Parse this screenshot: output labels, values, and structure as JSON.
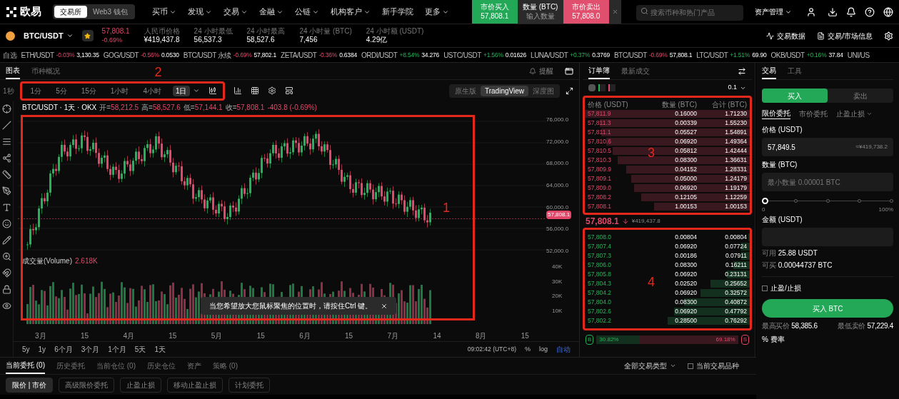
{
  "header": {
    "logo": "欧易",
    "mode_toggle": [
      {
        "label": "交易所",
        "selected": true
      },
      {
        "label": "Web3 钱包",
        "selected": false
      }
    ],
    "nav": [
      {
        "label": "买币",
        "dropdown": true
      },
      {
        "label": "发现",
        "dropdown": true
      },
      {
        "label": "交易",
        "dropdown": true
      },
      {
        "label": "金融",
        "dropdown": true
      },
      {
        "label": "公链",
        "dropdown": true
      },
      {
        "label": "机构客户",
        "dropdown": true
      },
      {
        "label": "新手学院",
        "dropdown": false
      },
      {
        "label": "更多",
        "dropdown": true
      }
    ],
    "quick_trade": {
      "buy_label": "市价买入",
      "buy_price": "57,808.1",
      "amount_label": "数量 (BTC)",
      "amount_placeholder": "输入数量",
      "sell_label": "市价卖出",
      "sell_price": "57,808.0"
    },
    "search": {
      "placeholder": "搜索币种和热门产品"
    },
    "assets_menu": "资产管理"
  },
  "pair_bar": {
    "pair": "BTC/USDT",
    "favorite": true,
    "price": "57,808.1",
    "change": "-0.69%",
    "rising": false,
    "stats": [
      {
        "label": "人民币价格",
        "value": "¥419,437.8"
      },
      {
        "label": "24 小时最低",
        "value": "56,537.3"
      },
      {
        "label": "24 小时最高",
        "value": "58,527.6"
      },
      {
        "label": "24 小时量 (BTC)",
        "value": "7,456"
      },
      {
        "label": "24 小时额 (USDT)",
        "value": "4.29亿"
      }
    ],
    "links": [
      {
        "label": "交易数据",
        "kind": "activity"
      },
      {
        "label": "交易/市场信息",
        "kind": "info"
      }
    ]
  },
  "tickers": {
    "watchlist": "自选",
    "items": [
      {
        "pair": "ETH/USDT",
        "change": "-0.03%",
        "price": "3,130.35",
        "rising": false
      },
      {
        "pair": "GOG/USDT",
        "change": "-0.56%",
        "price": "0.0530",
        "rising": false
      },
      {
        "pair": "BTC/USDT 永续",
        "change": "-0.69%",
        "price": "57,802.1",
        "rising": false
      },
      {
        "pair": "ZETA/USDT",
        "change": "-0.36%",
        "price": "0.6384",
        "rising": false
      },
      {
        "pair": "ORDI/USDT",
        "change": "+8.54%",
        "price": "34.276",
        "rising": true
      },
      {
        "pair": "USTC/USDT",
        "change": "+1.56%",
        "price": "0.01626",
        "rising": true
      },
      {
        "pair": "LUNA/USDT",
        "change": "+0.37%",
        "price": "0.3769",
        "rising": true
      },
      {
        "pair": "BTC/USDT",
        "change": "-0.69%",
        "price": "57,808.1",
        "rising": false
      },
      {
        "pair": "LTC/USDT",
        "change": "+1.51%",
        "price": "69.90",
        "rising": true
      },
      {
        "pair": "OKB/USDT",
        "change": "+0.16%",
        "price": "37.84",
        "rising": true
      },
      {
        "pair": "UNI/US"
      }
    ]
  },
  "chart": {
    "tabs": [
      {
        "label": "图表",
        "selected": true
      },
      {
        "label": "币种概况",
        "selected": false
      }
    ],
    "alert": "提醒",
    "first_interval": "1秒",
    "intervals": [
      {
        "label": "1分",
        "selected": false
      },
      {
        "label": "5分",
        "selected": false
      },
      {
        "label": "15分",
        "selected": false
      },
      {
        "label": "1小时",
        "selected": false
      },
      {
        "label": "4小时",
        "selected": false
      },
      {
        "label": "1日",
        "selected": true
      }
    ],
    "views": [
      {
        "label": "原生版",
        "selected": false
      },
      {
        "label": "TradingView",
        "selected": true
      },
      {
        "label": "深度图",
        "selected": false
      }
    ],
    "legend_title": "BTC/USDT · 1天 · OKX",
    "legend_values": [
      {
        "label": "开=",
        "value": "58,212.5"
      },
      {
        "label": "高=",
        "value": "58,527.6"
      },
      {
        "label": "低=",
        "value": "57,144.1"
      },
      {
        "label": "收=",
        "value": "57,808.1"
      }
    ],
    "legend_change": "-403.8 (-0.69%)",
    "price_ticks": [
      "76,000.0",
      "72,000.0",
      "68,000.0",
      "64,000.0",
      "60,000.0",
      "56,000.0",
      "52,000.0"
    ],
    "last_price": "57,808.1",
    "volume_label": "成交量(Volume)",
    "volume_value": "2.618K",
    "volume_ticks": [
      "40K",
      "30K",
      "20K",
      "10K"
    ],
    "x_ticks": [
      "3月",
      "15",
      "4月",
      "15",
      "5月",
      "15",
      "6月",
      "15",
      "7月",
      "14",
      "8月",
      "15"
    ],
    "toast": "当您希望放大您鼠标聚焦的位置时，请按住Ctrl 键。",
    "ranges": [
      "5y",
      "1y",
      "6个月",
      "3个月",
      "1个月",
      "5天",
      "1天"
    ],
    "clock": "09:02:42 (UTC+8)",
    "percent": "%",
    "log": "log",
    "auto": "自动"
  },
  "annotations": [
    {
      "label": "1"
    },
    {
      "label": "2"
    },
    {
      "label": "3"
    },
    {
      "label": "4"
    }
  ],
  "order_book": {
    "tabs": [
      {
        "label": "订单簿",
        "selected": true
      },
      {
        "label": "最新成交",
        "selected": false
      }
    ],
    "precision": "0.1",
    "columns": [
      "价格 (USDT)",
      "数量 (BTC)",
      "合计 (BTC)"
    ],
    "asks": [
      {
        "price": "57,811.9",
        "amount": "0.16000",
        "total": "1.71230",
        "level": 1.0
      },
      {
        "price": "57,811.3",
        "amount": "0.00339",
        "total": "1.55230",
        "level": 0.91
      },
      {
        "price": "57,811.1",
        "amount": "0.05527",
        "total": "1.54891",
        "level": 0.9
      },
      {
        "price": "57,810.6",
        "amount": "0.06920",
        "total": "1.49364",
        "level": 0.87
      },
      {
        "price": "57,810.5",
        "amount": "0.05812",
        "total": "1.42444",
        "level": 0.83
      },
      {
        "price": "57,810.3",
        "amount": "0.08300",
        "total": "1.36631",
        "level": 0.8
      },
      {
        "price": "57,809.9",
        "amount": "0.04152",
        "total": "1.28331",
        "level": 0.75
      },
      {
        "price": "57,809.1",
        "amount": "0.05000",
        "total": "1.24179",
        "level": 0.72
      },
      {
        "price": "57,809.0",
        "amount": "0.06920",
        "total": "1.19179",
        "level": 0.7
      },
      {
        "price": "57,808.2",
        "amount": "0.12105",
        "total": "1.12259",
        "level": 0.66
      },
      {
        "price": "57,808.1",
        "amount": "1.00153",
        "total": "1.00153",
        "level": 0.58
      }
    ],
    "mid_price": "57,808.1",
    "mid_fiat": "¥419,437.8",
    "bids": [
      {
        "price": "57,808.0",
        "amount": "0.00804",
        "total": "0.00804",
        "level": 0.01
      },
      {
        "price": "57,807.4",
        "amount": "0.06920",
        "total": "0.07724",
        "level": 0.05
      },
      {
        "price": "57,807.3",
        "amount": "0.00186",
        "total": "0.07911",
        "level": 0.05
      },
      {
        "price": "57,806.0",
        "amount": "0.08300",
        "total": "0.16211",
        "level": 0.1
      },
      {
        "price": "57,805.8",
        "amount": "0.06920",
        "total": "0.23131",
        "level": 0.14
      },
      {
        "price": "57,804.3",
        "amount": "0.02520",
        "total": "0.25652",
        "level": 0.24
      },
      {
        "price": "57,804.2",
        "amount": "0.06920",
        "total": "0.32572",
        "level": 0.3
      },
      {
        "price": "57,804.0",
        "amount": "0.08300",
        "total": "0.40872",
        "level": 0.4
      },
      {
        "price": "57,802.6",
        "amount": "0.06920",
        "total": "0.47792",
        "level": 0.46
      },
      {
        "price": "57,802.2",
        "amount": "0.28500",
        "total": "0.76292",
        "level": 0.5
      }
    ],
    "ratio": {
      "buy_label": "B",
      "buy_share": "30.82%",
      "sell_share": "69.18%",
      "sell_label": "S",
      "level": 0.3082
    }
  },
  "trade_panel": {
    "tabs": [
      {
        "label": "交易",
        "selected": true
      },
      {
        "label": "工具",
        "selected": false
      }
    ],
    "sides": [
      {
        "label": "买入",
        "selected": true
      },
      {
        "label": "卖出",
        "selected": false
      }
    ],
    "order_types": [
      {
        "label": "限价委托",
        "selected": true,
        "dropdown": false
      },
      {
        "label": "市价委托",
        "selected": false,
        "dropdown": false
      },
      {
        "label": "止盈止损",
        "selected": false,
        "dropdown": true
      }
    ],
    "price_label": "价格 (USDT)",
    "price_value": "57,849.5",
    "price_fiat": "≈¥419,738.2",
    "amount_label": "数量 (BTC)",
    "amount_placeholder": "最小数量 0.00001 BTC",
    "slider": {
      "level": 0,
      "min_label": "0",
      "max_label": "100%"
    },
    "total_label": "金额 (USDT)",
    "available": [
      {
        "label": "可用",
        "value": "25.88 USDT"
      },
      {
        "label": "可买",
        "value": "0.00044737 BTC"
      }
    ],
    "tp_sl": {
      "label": "止盈/止损",
      "checked": false
    },
    "submit": "买入 BTC",
    "limits": [
      {
        "label": "最高买价",
        "value": "58,385.6"
      },
      {
        "label": "最低卖价",
        "value": "57,229.4"
      }
    ],
    "fees": "% 费率"
  },
  "bottom": {
    "tabs": [
      {
        "label": "当前委托 (0)",
        "selected": true
      },
      {
        "label": "历史委托",
        "selected": false
      },
      {
        "label": "当前仓位 (0)",
        "selected": false
      },
      {
        "label": "历史仓位",
        "selected": false
      },
      {
        "label": "资产",
        "selected": false
      },
      {
        "label": "策略 (0)",
        "selected": false
      }
    ],
    "filters": [
      {
        "label": "限价 | 市价",
        "selected": true
      },
      {
        "label": "高级限价委托",
        "selected": false
      },
      {
        "label": "止盈止损",
        "selected": false
      },
      {
        "label": "移动止盈止损",
        "selected": false
      },
      {
        "label": "计划委托",
        "selected": false
      }
    ],
    "type_filter": "全部交易类型",
    "current_pair": {
      "label": "当前交易品种",
      "checked": false
    }
  }
}
